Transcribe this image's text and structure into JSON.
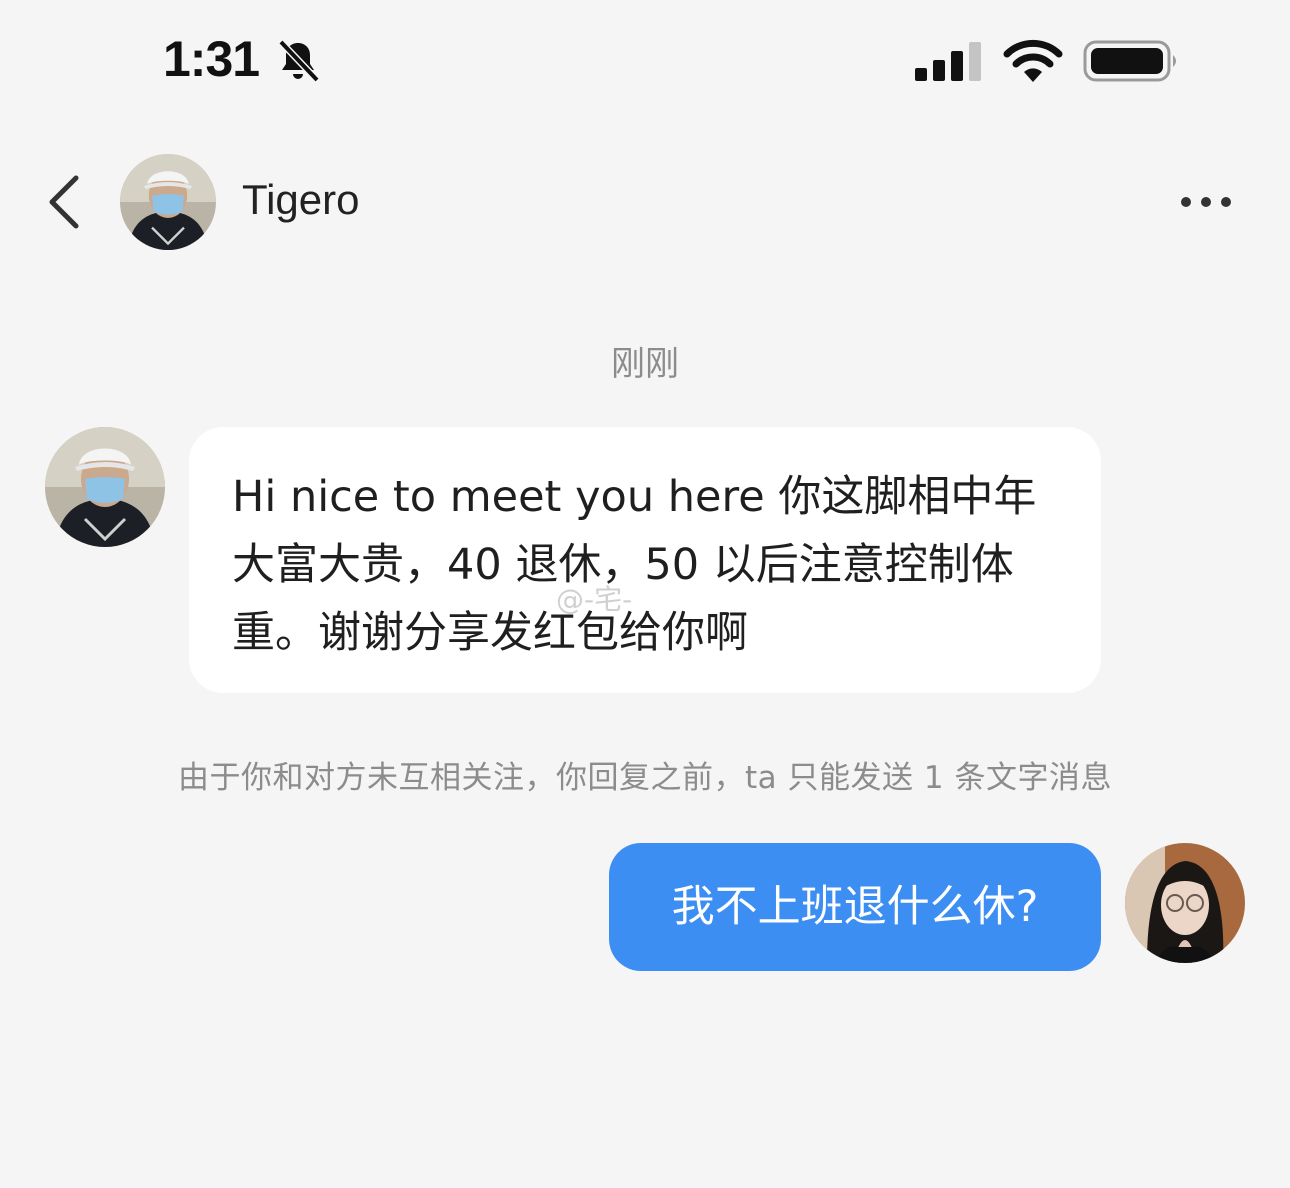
{
  "status_bar": {
    "time": "1:31",
    "mute_icon": "bell-slash-icon",
    "signal_icon": "cellular-signal-icon",
    "wifi_icon": "wifi-icon",
    "battery_icon": "battery-icon"
  },
  "header": {
    "back_icon": "chevron-left-icon",
    "contact_name": "Tigero",
    "more_icon": "ellipsis-icon"
  },
  "conversation": {
    "timestamp": "刚刚",
    "incoming": {
      "text": "Hi nice to meet you here 你这脚相中年大富大贵，40 退休，50 以后注意控制体重。谢谢分享发红包给你啊"
    },
    "notice": "由于你和对方未互相关注，你回复之前，ta 只能发送 1 条文字消息",
    "outgoing": {
      "text": "我不上班退什么休?"
    }
  },
  "watermark": "@-宅-",
  "colors": {
    "background": "#f5f5f5",
    "incoming_bubble": "#ffffff",
    "outgoing_bubble": "#3c8ef2",
    "muted_text": "#8c8c8c"
  }
}
